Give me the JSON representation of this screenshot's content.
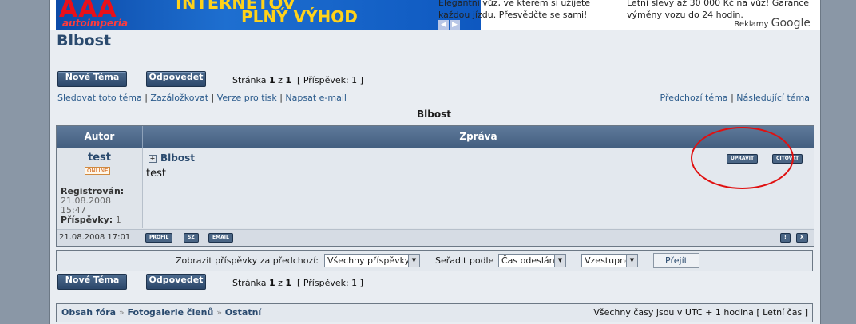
{
  "banner": {
    "brand": "AAA",
    "brand_sub": "autoimperia",
    "headline_1": "INTERNETOV",
    "headline_2": "PLNÝ VÝHOD"
  },
  "ads": {
    "ad1_line1": "Elegantní vůz, ve kterém si užijete",
    "ad1_line2": "každou jízdu. Přesvědčte se sami!",
    "ad2_line1": "Letní slevy až 30 000 Kč na vůz! Garance",
    "ad2_line2": "výměny vozu do 24 hodin.",
    "reklamy": "Reklamy",
    "google": "Google"
  },
  "page_title": "Blbost",
  "buttons": {
    "new_topic": "Nové Téma",
    "reply": "Odpovedet"
  },
  "pagination": {
    "text_prefix": "Stránka",
    "current": "1",
    "of": "z",
    "total": "1",
    "posts": "[ Příspěvek: 1 ]"
  },
  "topic_links": {
    "watch": "Sledovat toto téma",
    "bookmark": "Zazáložkovat",
    "print": "Verze pro tisk",
    "email": "Napsat e-mail",
    "prev_topic": "Předchozí téma",
    "next_topic": "Následující téma"
  },
  "topic_title": "Blbost",
  "table": {
    "col_author": "Autor",
    "col_message": "Zpráva"
  },
  "post": {
    "author": "test",
    "status": "ONLINE",
    "registered_label": "Registrován:",
    "registered_date": "21.08.2008",
    "registered_time": "15:47",
    "posts_label": "Příspěvky:",
    "posts_count": "1",
    "subject": "Blbost",
    "body": "test",
    "edit": "UPRAVIT",
    "quote": "CITOVAT",
    "date": "21.08.2008 17:01",
    "profile": "PROFIL",
    "pm": "SZ",
    "email": "EMAIL",
    "report": "!",
    "delete": "X"
  },
  "sort": {
    "show_label": "Zobrazit příspěvky za předchozí:",
    "show_value": "Všechny příspěvky",
    "sort_label": "Seřadit podle",
    "sort_value": "Čas odeslání",
    "order_value": "Vzestupně",
    "go": "Přejít"
  },
  "breadcrumb": {
    "item1": "Obsah fóra",
    "item2": "Fotogalerie členů",
    "item3": "Ostatní",
    "sep": "»"
  },
  "timezone": "Všechny časy jsou v UTC + 1 hodina [ Letní čas ]"
}
